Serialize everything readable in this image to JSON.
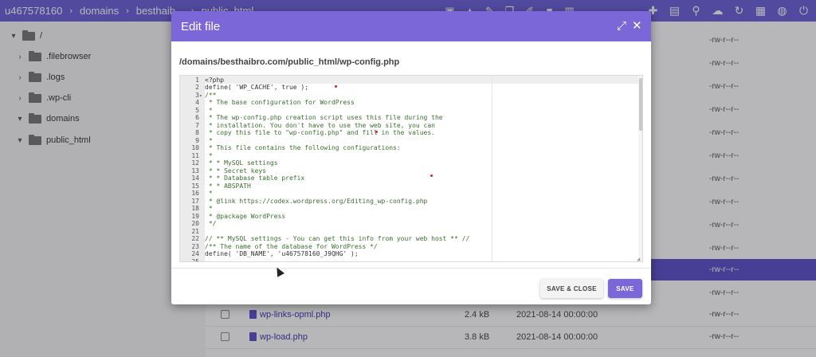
{
  "breadcrumb": {
    "items": [
      "u467578160",
      "domains",
      "besthaib...",
      "public_html"
    ],
    "separator": "›"
  },
  "toolbar": {
    "icons": [
      "new-folder-icon",
      "upload-icon",
      "edit-icon",
      "copy-icon",
      "rename-icon",
      "lock-icon",
      "delete-icon"
    ],
    "right_icons": [
      "new-file-icon",
      "add-folder-icon",
      "search-icon",
      "cloud-upload-icon",
      "refresh-icon",
      "grid-icon",
      "globe-icon",
      "power-icon"
    ]
  },
  "tree": {
    "items": [
      {
        "label": "/",
        "expanded": true
      },
      {
        "label": ".filebrowser",
        "expanded": false
      },
      {
        "label": ".logs",
        "expanded": false
      },
      {
        "label": ".wp-cli",
        "expanded": false
      },
      {
        "label": "domains",
        "expanded": true
      },
      {
        "label": "public_html",
        "expanded": true
      }
    ]
  },
  "file_list": {
    "permissions": [
      "-rw-r--r--",
      "-rw-r--r--",
      "-rw-r--r--",
      "-rw-r--r--",
      "-rw-r--r--",
      "-rw-r--r--",
      "-rw-r--r--",
      "-rw-r--r--",
      "-rw-r--r--",
      "-rw-r--r--",
      "-rw-r--r--",
      "-rw-r--r--"
    ],
    "rows": [
      {
        "name": "wp-links-opml.php",
        "size": "2.4 kB",
        "date": "2021-08-14 00:00:00",
        "perm": "-rw-r--r--"
      },
      {
        "name": "wp-load.php",
        "size": "3.8 kB",
        "date": "2021-08-14 00:00:00",
        "perm": "-rw-r--r--"
      }
    ]
  },
  "modal": {
    "title": "Edit file",
    "path": "/domains/besthaibro.com/public_html/wp-config.php",
    "save_close_label": "SAVE & CLOSE",
    "save_label": "SAVE",
    "lines": [
      {
        "n": "1",
        "text": "<?php",
        "comment": false
      },
      {
        "n": "2",
        "text": "define( 'WP_CACHE', true );",
        "comment": false
      },
      {
        "n": "3",
        "text": "/**",
        "comment": true,
        "fold": true
      },
      {
        "n": "4",
        "text": " * The base configuration for WordPress",
        "comment": true
      },
      {
        "n": "5",
        "text": " *",
        "comment": true
      },
      {
        "n": "6",
        "text": " * The wp-config.php creation script uses this file during the",
        "comment": true
      },
      {
        "n": "7",
        "text": " * installation. You don't have to use the web site, you can",
        "comment": true
      },
      {
        "n": "8",
        "text": " * copy this file to \"wp-config.php\" and fill in the values.",
        "comment": true
      },
      {
        "n": "9",
        "text": " *",
        "comment": true
      },
      {
        "n": "10",
        "text": " * This file contains the following configurations:",
        "comment": true
      },
      {
        "n": "11",
        "text": " *",
        "comment": true
      },
      {
        "n": "12",
        "text": " * * MySQL settings",
        "comment": true
      },
      {
        "n": "13",
        "text": " * * Secret keys",
        "comment": true
      },
      {
        "n": "14",
        "text": " * * Database table prefix",
        "comment": true
      },
      {
        "n": "15",
        "text": " * * ABSPATH",
        "comment": true
      },
      {
        "n": "16",
        "text": " *",
        "comment": true
      },
      {
        "n": "17",
        "text": " * @link https://codex.wordpress.org/Editing_wp-config.php",
        "comment": true
      },
      {
        "n": "18",
        "text": " *",
        "comment": true
      },
      {
        "n": "19",
        "text": " * @package WordPress",
        "comment": true
      },
      {
        "n": "20",
        "text": " */",
        "comment": true
      },
      {
        "n": "21",
        "text": "",
        "comment": false
      },
      {
        "n": "22",
        "text": "// ** MySQL settings - You can get this info from your web host ** //",
        "comment": true
      },
      {
        "n": "23",
        "text": "/** The name of the database for WordPress */",
        "comment": true
      },
      {
        "n": "24",
        "text": "define( 'DB_NAME', 'u467578160_J9QHG' );",
        "comment": false
      },
      {
        "n": "25",
        "text": "",
        "comment": false
      }
    ]
  },
  "colors": {
    "accent": "#7c67d8",
    "topbar": "#6b5fd6",
    "selected_row": "#5b4fc9",
    "comment": "#3c6e2f"
  }
}
